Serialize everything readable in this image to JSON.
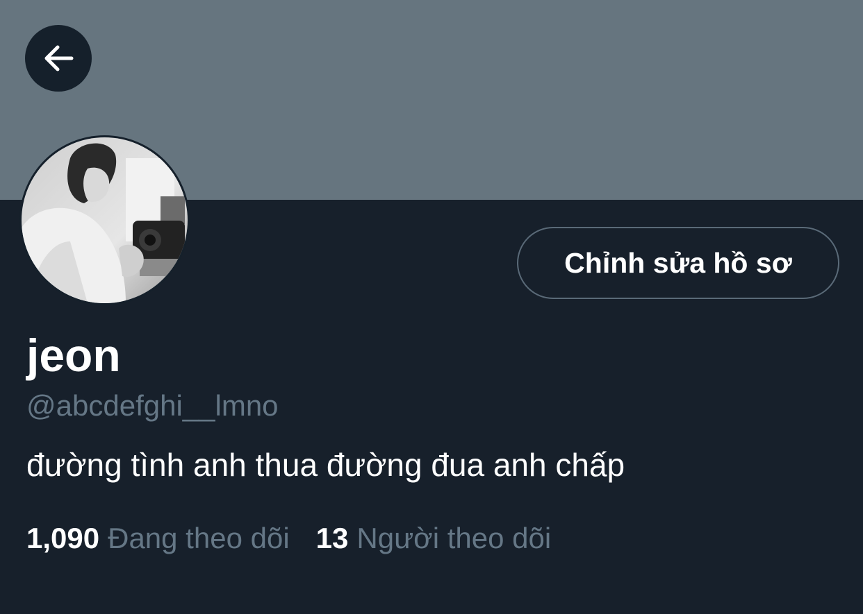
{
  "profile": {
    "display_name": "jeon",
    "handle": "@abcdefghi__lmno",
    "bio": "đường tình anh thua đường đua anh chấp",
    "edit_button_label": "Chỉnh sửa hồ sơ"
  },
  "stats": {
    "following_count": "1,090",
    "following_label": "Đang theo dõi",
    "followers_count": "13",
    "followers_label": "Người theo dõi"
  },
  "icons": {
    "back": "arrow-left-icon"
  },
  "colors": {
    "banner": "#66757f",
    "background": "#17202b",
    "text_primary": "#ffffff",
    "text_secondary": "#657786",
    "button_border": "#5a6a78"
  }
}
